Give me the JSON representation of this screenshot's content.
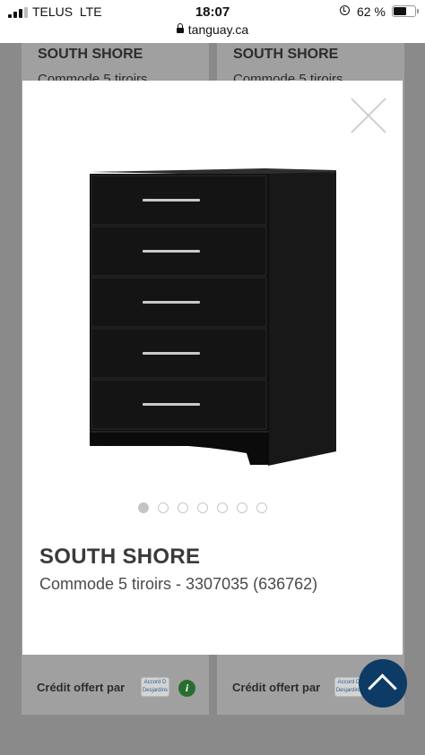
{
  "status_bar": {
    "carrier": "TELUS",
    "network": "LTE",
    "time": "18:07",
    "url": "tanguay.ca",
    "battery_percent": "62 %",
    "battery_level": 0.62
  },
  "background_cards": [
    {
      "brand": "SOUTH SHORE",
      "title": "Commode 5 tiroirs",
      "credit_label": "Crédit offert par",
      "financing_logo": "Accord D Desjardins",
      "info_icon": "i"
    },
    {
      "brand": "SOUTH SHORE",
      "title": "Commode 5 tiroirs",
      "credit_label": "Crédit offert par",
      "financing_logo": "Accord D Desjardins"
    }
  ],
  "modal": {
    "image_alt": "black-5-drawer-dresser",
    "dots_total": 7,
    "active_dot": 1,
    "brand": "SOUTH SHORE",
    "title": "Commode 5 tiroirs - 3307035 (636762)"
  },
  "icons": {
    "close": "close-icon",
    "scroll_top": "chevron-up-icon",
    "lock": "lock-icon"
  },
  "colors": {
    "scroll_button": "#0e3b66",
    "info_badge": "#2a6e2f",
    "overlay": "#8a8a8a"
  }
}
